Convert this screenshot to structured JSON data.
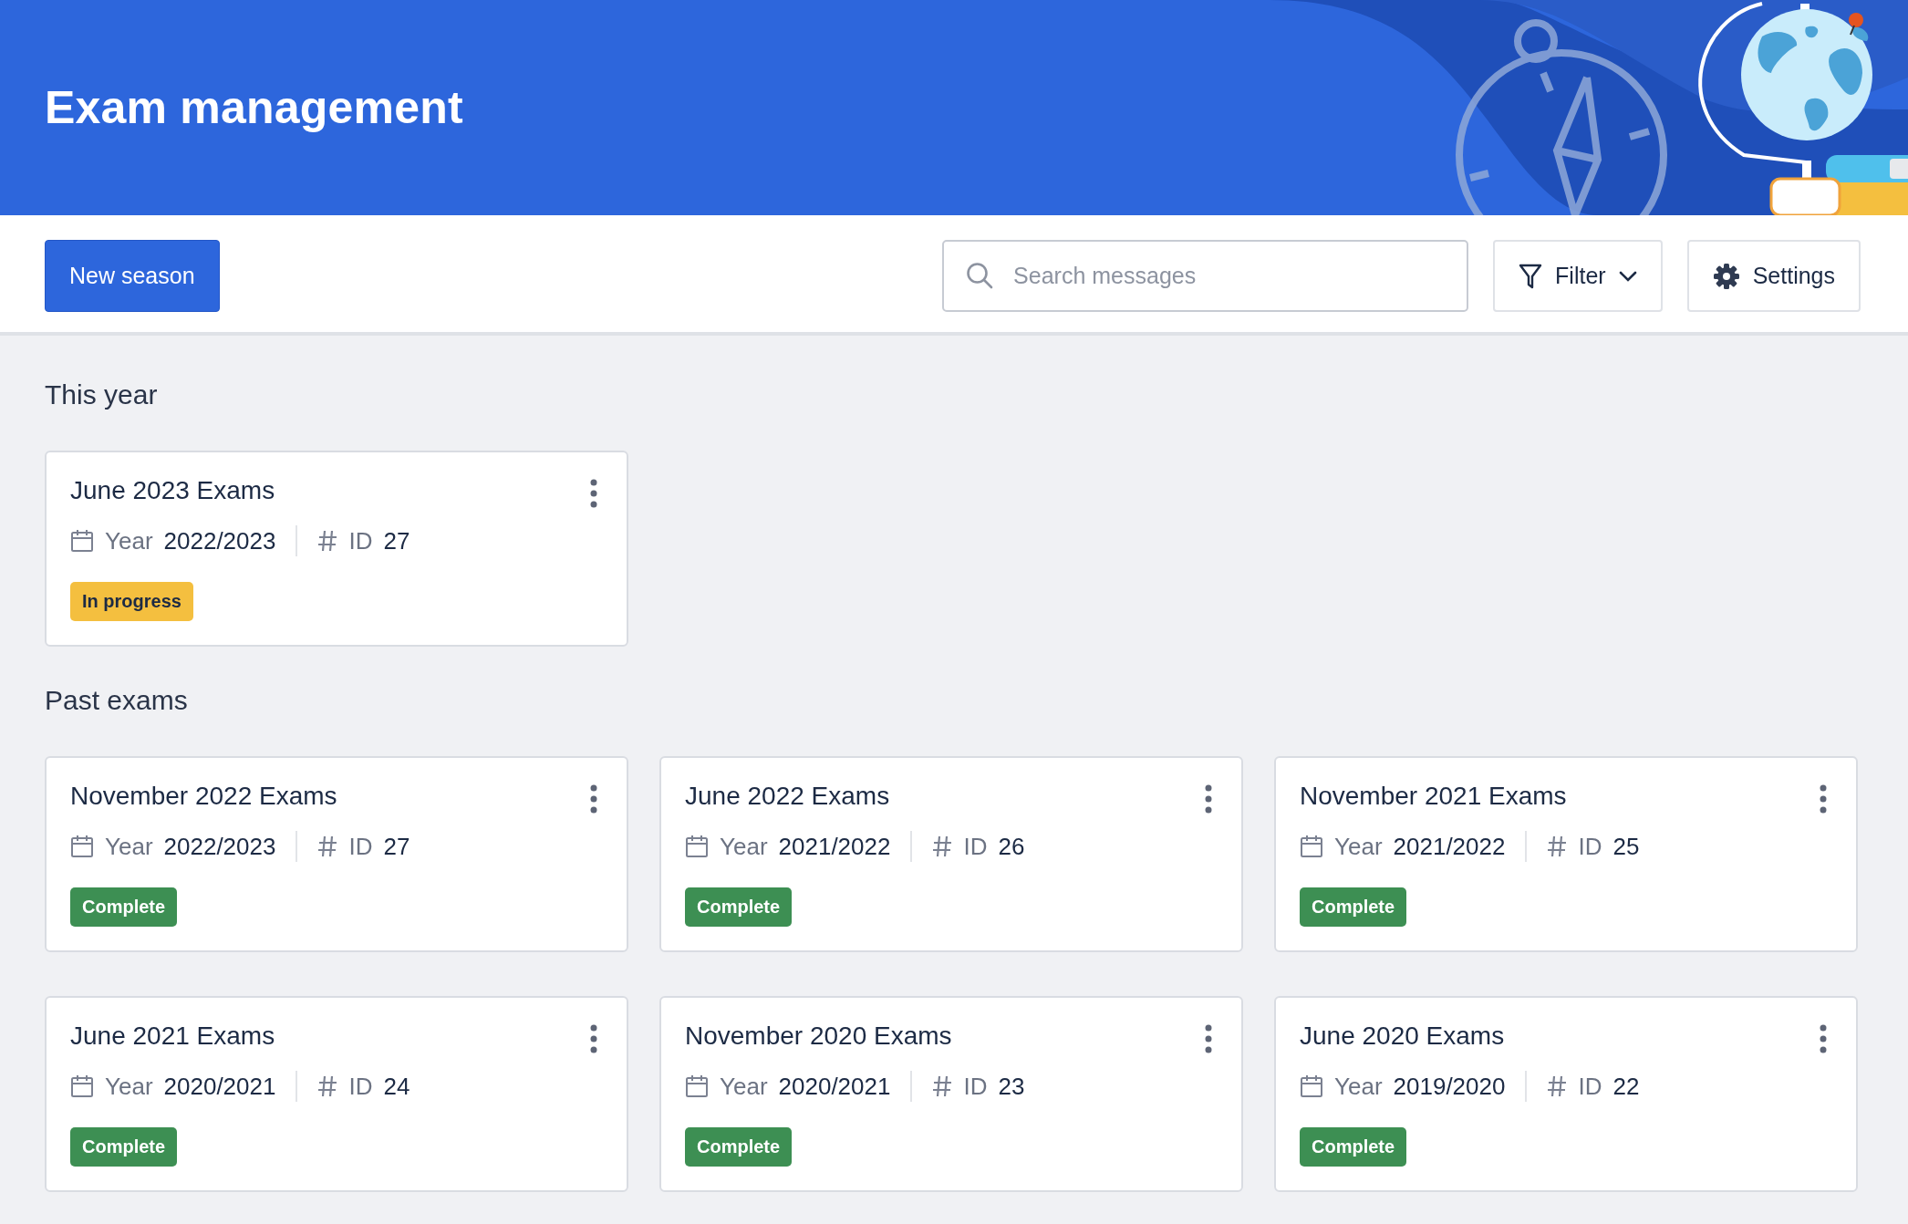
{
  "header": {
    "title": "Exam management"
  },
  "toolbar": {
    "new_button": "New season",
    "search": {
      "placeholder": "Search messages"
    },
    "filter_button": "Filter",
    "settings_button": "Settings"
  },
  "sections": [
    {
      "title": "This year",
      "cards": [
        {
          "title": "June 2023 Exams",
          "year_label": "Year",
          "year": "2022/2023",
          "id_label": "ID",
          "id": "27",
          "status": {
            "label": "In progress",
            "color": "#f4bf3f"
          }
        }
      ]
    },
    {
      "title": "Past exams",
      "cards": [
        {
          "title": "November 2022 Exams",
          "year_label": "Year",
          "year": "2022/2023",
          "id_label": "ID",
          "id": "27",
          "status": {
            "label": "Complete",
            "color": "#3d8f53"
          }
        },
        {
          "title": "June 2022 Exams",
          "year_label": "Year",
          "year": "2021/2022",
          "id_label": "ID",
          "id": "26",
          "status": {
            "label": "Complete",
            "color": "#3d8f53"
          }
        },
        {
          "title": "November 2021 Exams",
          "year_label": "Year",
          "year": "2021/2022",
          "id_label": "ID",
          "id": "25",
          "status": {
            "label": "Complete",
            "color": "#3d8f53"
          }
        },
        {
          "title": "June 2021 Exams",
          "year_label": "Year",
          "year": "2020/2021",
          "id_label": "ID",
          "id": "24",
          "status": {
            "label": "Complete",
            "color": "#3d8f53"
          }
        },
        {
          "title": "November 2020 Exams",
          "year_label": "Year",
          "year": "2020/2021",
          "id_label": "ID",
          "id": "23",
          "status": {
            "label": "Complete",
            "color": "#3d8f53"
          }
        },
        {
          "title": "June 2020 Exams",
          "year_label": "Year",
          "year": "2019/2020",
          "id_label": "ID",
          "id": "22",
          "status": {
            "label": "Complete",
            "color": "#3d8f53"
          }
        }
      ]
    }
  ]
}
